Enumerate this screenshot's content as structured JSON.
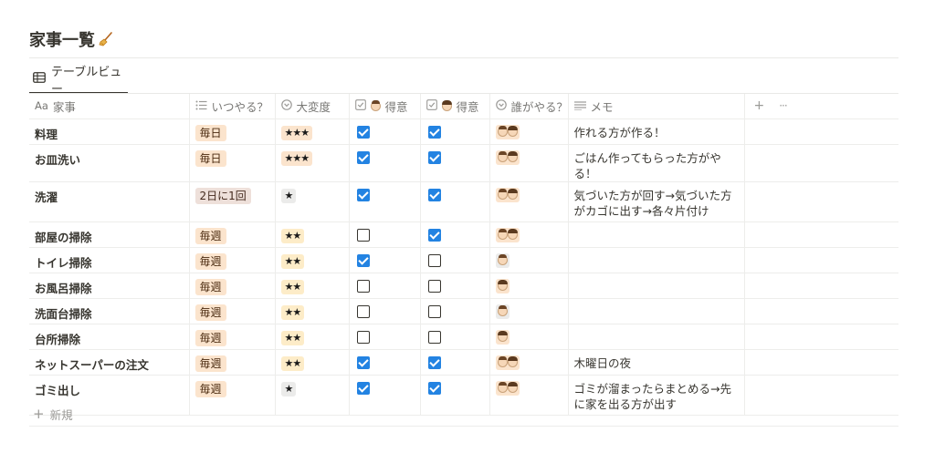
{
  "page": {
    "title": "家事一覧"
  },
  "view": {
    "tab_label": "テーブルビュー"
  },
  "columns": [
    {
      "key": "task",
      "prefix": "Aa",
      "label": "家事"
    },
    {
      "key": "freq",
      "label": "いつやる？"
    },
    {
      "key": "effort",
      "label": "大変度"
    },
    {
      "key": "good_a",
      "label": "得意"
    },
    {
      "key": "good_b",
      "label": "得意"
    },
    {
      "key": "who",
      "label": "誰がやる？"
    },
    {
      "key": "memo",
      "label": "メモ"
    }
  ],
  "header_actions": {
    "add": "+",
    "more": "···"
  },
  "rows": [
    {
      "task": "料理",
      "freq": "毎日",
      "effort": "★★★",
      "good_a": true,
      "good_b": true,
      "who": "both",
      "memo": "作れる方が作る！"
    },
    {
      "task": "お皿洗い",
      "freq": "毎日",
      "effort": "★★★",
      "good_a": true,
      "good_b": true,
      "who": "both",
      "memo": "ごはん作ってもらった方がやる！"
    },
    {
      "task": "洗濯",
      "freq": "2日に1回",
      "effort": "★",
      "good_a": true,
      "good_b": true,
      "who": "both",
      "memo": "気づいた方が回す→気づいた方がカゴに出す→各々片付け"
    },
    {
      "task": "部屋の掃除",
      "freq": "毎週",
      "effort": "★★",
      "good_a": false,
      "good_b": true,
      "who": "both",
      "memo": ""
    },
    {
      "task": "トイレ掃除",
      "freq": "毎週",
      "effort": "★★",
      "good_a": true,
      "good_b": false,
      "who": "a",
      "memo": ""
    },
    {
      "task": "お風呂掃除",
      "freq": "毎週",
      "effort": "★★",
      "good_a": false,
      "good_b": false,
      "who": "b",
      "memo": ""
    },
    {
      "task": "洗面台掃除",
      "freq": "毎週",
      "effort": "★★",
      "good_a": false,
      "good_b": false,
      "who": "a",
      "memo": ""
    },
    {
      "task": "台所掃除",
      "freq": "毎週",
      "effort": "★★",
      "good_a": false,
      "good_b": false,
      "who": "b",
      "memo": ""
    },
    {
      "task": "ネットスーパーの注文",
      "freq": "毎週",
      "effort": "★★",
      "good_a": true,
      "good_b": true,
      "who": "both",
      "memo": "木曜日の夜"
    },
    {
      "task": "ゴミ出し",
      "freq": "毎週",
      "effort": "★",
      "good_a": true,
      "good_b": true,
      "who": "both",
      "memo": "ゴミが溜まったらまとめる→先に家を出る方が出す"
    }
  ],
  "new_row": {
    "label": "新規"
  }
}
